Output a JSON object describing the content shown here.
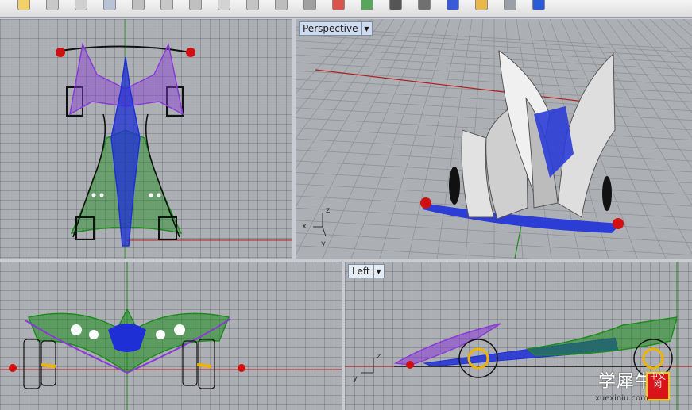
{
  "toolbar": {
    "icons": [
      "file-icon",
      "lock-icon",
      "select-icon",
      "curve-icon",
      "line-icon",
      "circle-icon",
      "arc-icon",
      "zoom-icon",
      "pan-icon",
      "rotate-icon",
      "surface-icon",
      "render-icon",
      "color-wheel-icon",
      "shade-icon",
      "light-icon",
      "material-icon",
      "settings-icon",
      "tools-icon",
      "help-icon"
    ]
  },
  "viewports": {
    "top": {
      "label": ""
    },
    "perspective": {
      "label": "Perspective",
      "axes": {
        "x": "x",
        "y": "y",
        "z": "z"
      }
    },
    "front": {
      "label": ""
    },
    "left": {
      "label": "Left",
      "axes": {
        "y": "y",
        "z": "z"
      }
    }
  },
  "watermark": {
    "title": "学犀牛",
    "url": "xuexiniu.com",
    "seal": "中文网"
  },
  "colors": {
    "viewport_bg": "#acafb3",
    "grid": "#8f9399",
    "axis_x": "#b22020",
    "axis_y": "#1e8a1e",
    "model_blue": "#1f2fd6",
    "model_purple": "#8a39d6",
    "model_green": "#1d8c1d",
    "model_red": "#d01010",
    "wheel_yellow": "#f0b400"
  }
}
